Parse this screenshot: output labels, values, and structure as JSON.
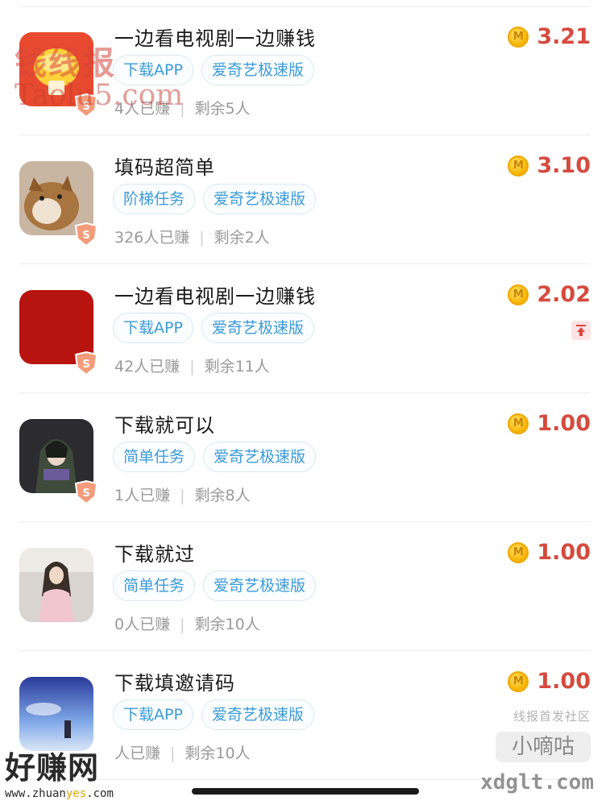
{
  "tasks": [
    {
      "title": "一边看电视剧一边赚钱",
      "tags": [
        "下载APP",
        "爱奇艺极速版"
      ],
      "earned": "4人已赚",
      "remaining": "剩余5人",
      "reward": "3.21",
      "thumb": "red-gold-icon",
      "has_top_badge": false
    },
    {
      "title": "填码超简单",
      "tags": [
        "阶梯任务",
        "爱奇艺极速版"
      ],
      "earned": "326人已赚",
      "remaining": "剩余2人",
      "reward": "3.10",
      "thumb": "dog-photo",
      "has_top_badge": false
    },
    {
      "title": "一边看电视剧一边赚钱",
      "tags": [
        "下载APP",
        "爱奇艺极速版"
      ],
      "earned": "42人已赚",
      "remaining": "剩余11人",
      "reward": "2.02",
      "thumb": "red-square",
      "has_top_badge": true
    },
    {
      "title": "下载就可以",
      "tags": [
        "简单任务",
        "爱奇艺极速版"
      ],
      "earned": "1人已赚",
      "remaining": "剩余8人",
      "reward": "1.00",
      "thumb": "anime-character",
      "has_top_badge": false
    },
    {
      "title": "下载就过",
      "tags": [
        "简单任务",
        "爱奇艺极速版"
      ],
      "earned": "0人已赚",
      "remaining": "剩余10人",
      "reward": "1.00",
      "thumb": "person-photo",
      "has_top_badge": false
    },
    {
      "title": "下载填邀请码",
      "tags": [
        "下载APP",
        "爱奇艺极速版"
      ],
      "earned": "人已赚",
      "remaining": "剩余10人",
      "reward": "1.00",
      "thumb": "sky-scene",
      "has_top_badge": false
    }
  ],
  "coin_letter": "M",
  "shield_letter": "S",
  "separator": "|",
  "watermarks": {
    "top_left_line1": "钱线报",
    "top_left_line2": "Taolu5.com",
    "bottom_left_line1": "好赚网",
    "bottom_left_line2_a": "www.zhuan",
    "bottom_left_line2_b": "yes",
    "bottom_left_line2_c": ".com",
    "bottom_right_line1": "线报首发社区",
    "bottom_right_line2": "小嘀咕",
    "bottom_right_line3": "xdglt.com"
  },
  "colors": {
    "tag_text": "#3a9bd9",
    "reward": "#d64a3e",
    "coin": "#f5b300",
    "shield": "#f08a6a"
  }
}
